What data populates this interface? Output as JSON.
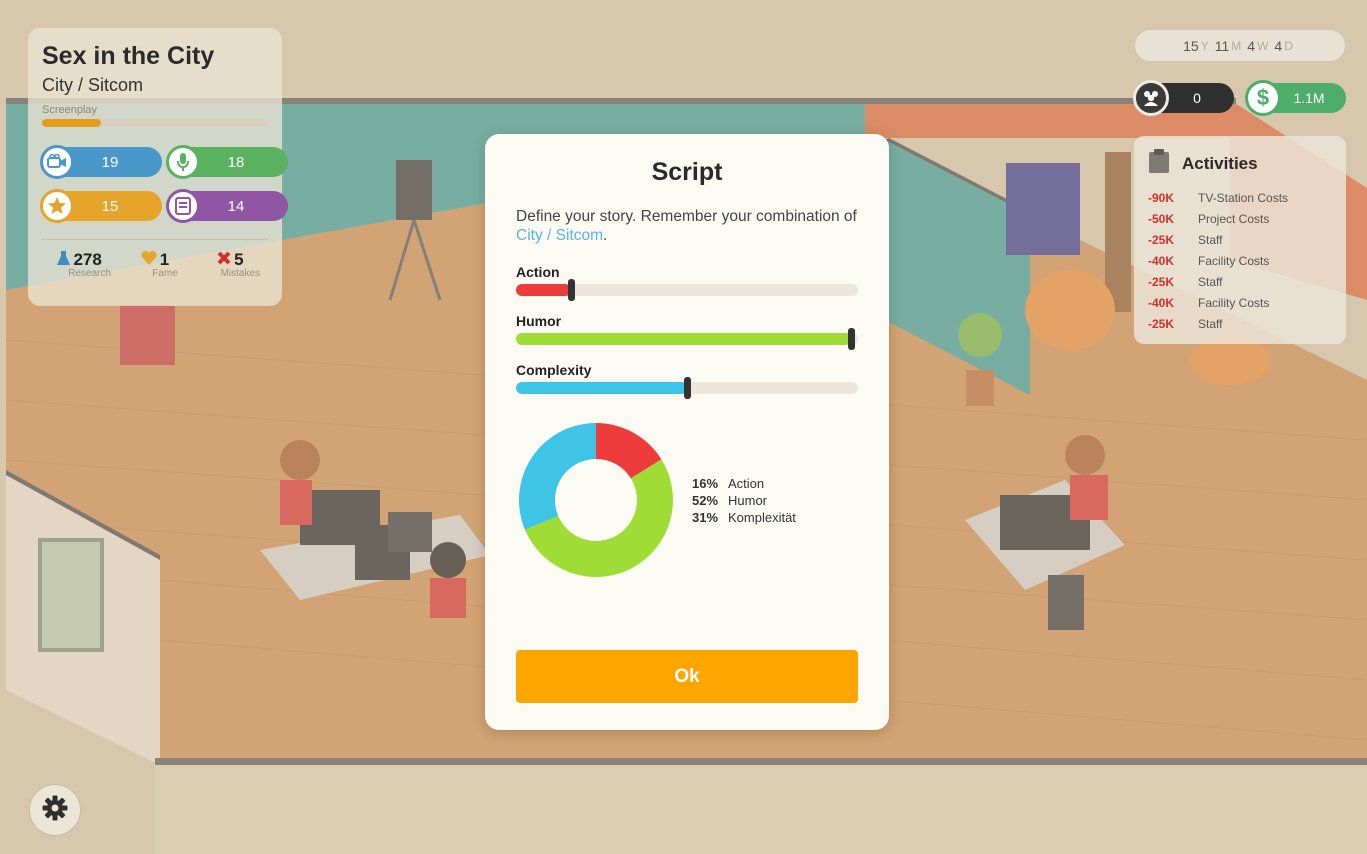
{
  "project": {
    "title": "Sex in the City",
    "genre": "City / Sitcom",
    "phase_label": "Screenplay",
    "phase_progress": 0.26,
    "stats": [
      {
        "icon": "camera-icon",
        "value": "19",
        "color": "#4a97c9"
      },
      {
        "icon": "microphone-icon",
        "value": "18",
        "color": "#5ab260"
      },
      {
        "icon": "star-icon",
        "value": "15",
        "color": "#e6a52a"
      },
      {
        "icon": "script-icon",
        "value": "14",
        "color": "#8e56a3"
      }
    ],
    "summary": [
      {
        "icon": "flask-icon",
        "value": "278",
        "label": "Research"
      },
      {
        "icon": "heart-icon",
        "value": "1",
        "label": "Fame"
      },
      {
        "icon": "x-icon",
        "value": "5",
        "label": "Mistakes"
      }
    ]
  },
  "date": {
    "years": "15",
    "y_unit": "Y",
    "months": "11",
    "m_unit": "M",
    "weeks": "4",
    "w_unit": "W",
    "days": "4",
    "d_unit": "D"
  },
  "fans": {
    "icon": "fans-icon",
    "value": "0"
  },
  "money": {
    "icon": "dollar-icon",
    "symbol": "$",
    "value": "1.1M"
  },
  "activities": {
    "icon": "clipboard-icon",
    "title": "Activities",
    "items": [
      {
        "amount": "-90K",
        "label": "TV-Station Costs"
      },
      {
        "amount": "-50K",
        "label": "Project Costs"
      },
      {
        "amount": "-25K",
        "label": "Staff"
      },
      {
        "amount": "-40K",
        "label": "Facility Costs"
      },
      {
        "amount": "-25K",
        "label": "Staff"
      },
      {
        "amount": "-40K",
        "label": "Facility Costs"
      },
      {
        "amount": "-25K",
        "label": "Staff"
      }
    ]
  },
  "modal": {
    "title": "Script",
    "description_prefix": "Define your story. Remember your combination of ",
    "description_genre": "City / Sitcom",
    "description_suffix": ".",
    "sliders": [
      {
        "label": "Action",
        "value": 0.16,
        "color": "#ee3b3b"
      },
      {
        "label": "Humor",
        "value": 0.98,
        "color": "#9fdc35"
      },
      {
        "label": "Complexity",
        "value": 0.5,
        "color": "#3ec4e6"
      }
    ],
    "ok_label": "Ok"
  },
  "chart_data": {
    "type": "pie",
    "categories": [
      "Action",
      "Humor",
      "Komplexität"
    ],
    "values": [
      16,
      52,
      31
    ],
    "labels": [
      "16%",
      "52%",
      "31%"
    ],
    "colors": [
      "#ee3b3b",
      "#9fdc35",
      "#3ec4e6"
    ],
    "title": "",
    "donut": true
  },
  "settings": {
    "icon": "gear-icon"
  }
}
